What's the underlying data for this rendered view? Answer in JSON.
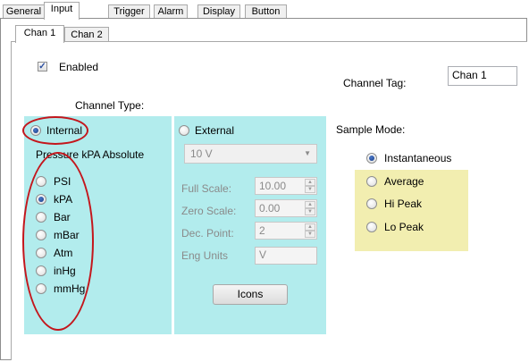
{
  "tabs": [
    "General",
    "Input",
    "Trigger",
    "Alarm",
    "Display",
    "Button"
  ],
  "channel_tabs": [
    "Chan 1",
    "Chan 2"
  ],
  "enabled": {
    "label": "Enabled",
    "checked": true
  },
  "channel_tag": {
    "label": "Channel Tag:",
    "value": "Chan 1"
  },
  "channel_type": {
    "title": "Channel Type:",
    "internal": {
      "label": "Internal",
      "selected": true,
      "subtitle": "Pressure kPA Absolute",
      "units": [
        "PSI",
        "kPA",
        "Bar",
        "mBar",
        "Atm",
        "inHg",
        "mmHg"
      ],
      "selected_unit": "kPA"
    },
    "external": {
      "label": "External",
      "selected": false,
      "range": "10 V",
      "full_scale": {
        "label": "Full Scale:",
        "value": "10.00"
      },
      "zero_scale": {
        "label": "Zero Scale:",
        "value": "0.00"
      },
      "dec_point": {
        "label": "Dec. Point:",
        "value": "2"
      },
      "eng_units": {
        "label": "Eng Units",
        "value": "V"
      },
      "icons_button": "Icons"
    }
  },
  "sample_mode": {
    "title": "Sample Mode:",
    "options": [
      "Instantaneous",
      "Average",
      "Hi Peak",
      "Lo Peak"
    ],
    "selected": "Instantaneous"
  },
  "colors": {
    "cyan_panel": "#b2eced",
    "yellow_panel": "#f2eeb0",
    "annotation": "#c4161c"
  }
}
